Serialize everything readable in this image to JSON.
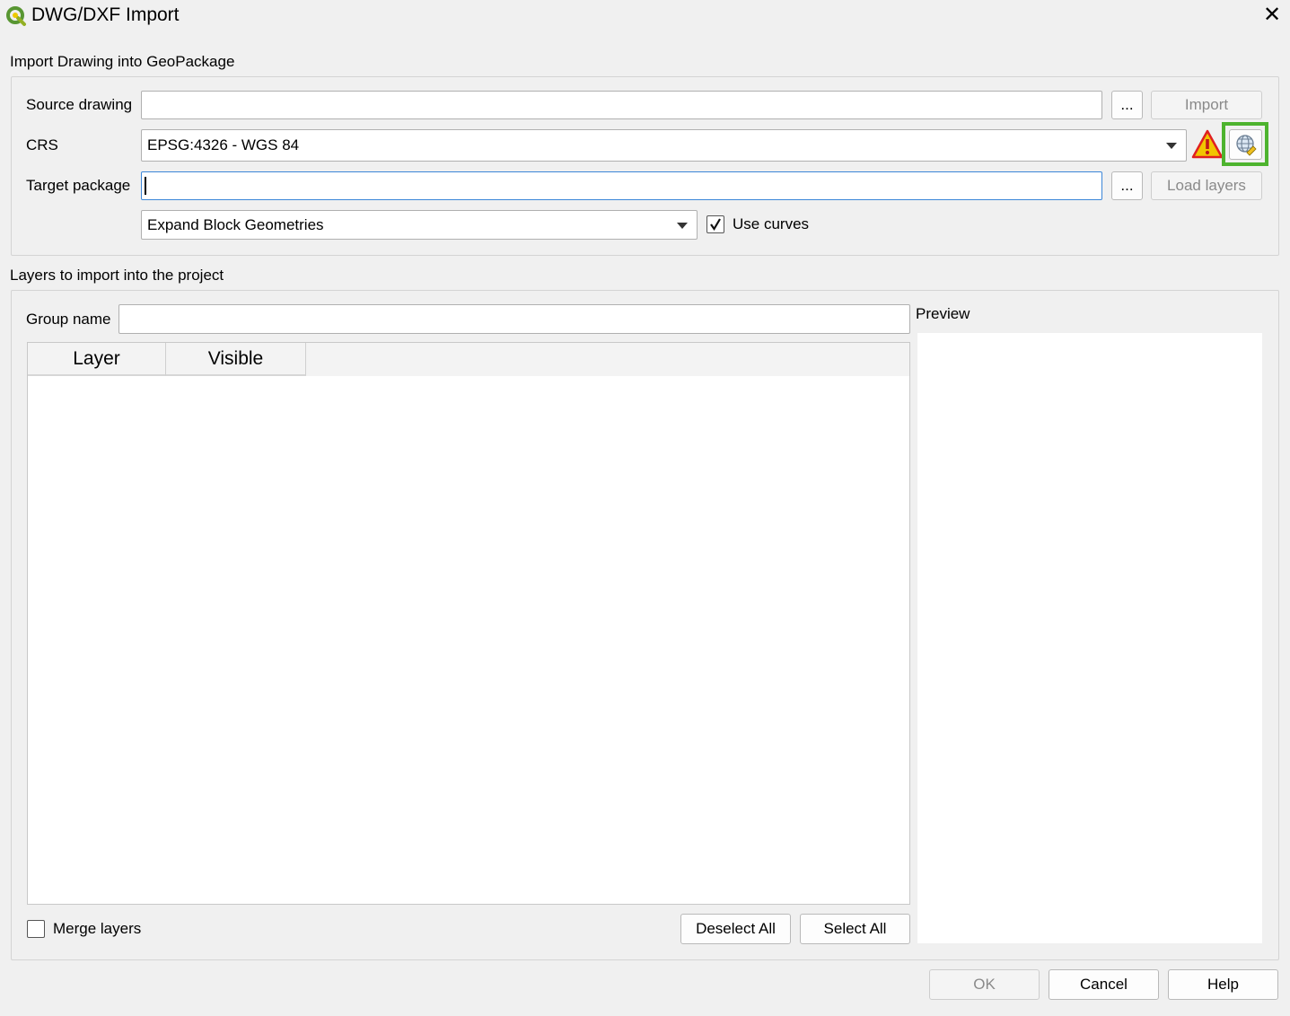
{
  "window": {
    "title": "DWG/DXF Import",
    "close_glyph": "✕"
  },
  "import_section": {
    "title": "Import Drawing into GeoPackage",
    "source_drawing_label": "Source drawing",
    "source_drawing_value": "",
    "browse_label": "...",
    "import_button": "Import",
    "crs_label": "CRS",
    "crs_value": "EPSG:4326 - WGS 84",
    "target_package_label": "Target package",
    "target_package_value": "",
    "browse_target_label": "...",
    "load_layers_button": "Load layers",
    "block_mode_value": "Expand Block Geometries",
    "use_curves_label": "Use curves",
    "use_curves_checked": true
  },
  "layers_section": {
    "title": "Layers to import into the project",
    "group_name_label": "Group name",
    "group_name_value": "",
    "columns": [
      "Layer",
      "Visible"
    ],
    "preview_label": "Preview",
    "merge_layers_label": "Merge layers",
    "merge_layers_checked": false,
    "deselect_all_button": "Deselect All",
    "select_all_button": "Select All"
  },
  "footer": {
    "ok_button": "OK",
    "cancel_button": "Cancel",
    "help_button": "Help"
  },
  "colors": {
    "highlight": "#4db32e",
    "warning": "#f2c500",
    "focus": "#3c86d8"
  },
  "icons": [
    "qgis-logo-icon",
    "close-icon",
    "warning-icon",
    "crs-select-icon",
    "chevron-down-icon",
    "checkmark-icon"
  ]
}
